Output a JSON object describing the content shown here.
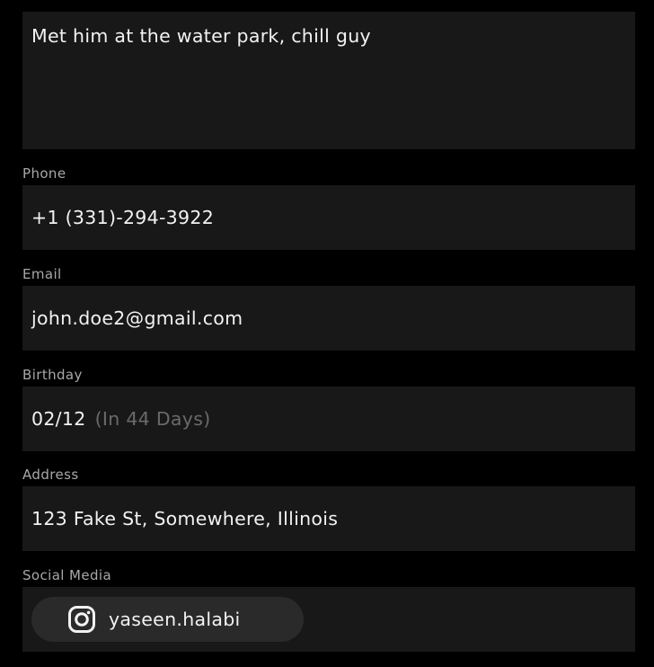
{
  "notes": {
    "text": "Met him at the water park, chill guy"
  },
  "phone": {
    "label": "Phone",
    "value": "+1 (331)-294-3922"
  },
  "email": {
    "label": "Email",
    "value": "john.doe2@gmail.com"
  },
  "birthday": {
    "label": "Birthday",
    "value": "02/12",
    "countdown": "(In 44 Days)"
  },
  "address": {
    "label": "Address",
    "value": "123 Fake St, Somewhere, Illinois"
  },
  "social": {
    "label": "Social Media",
    "items": [
      {
        "icon": "instagram-icon",
        "handle": "yaseen.halabi"
      }
    ]
  },
  "colors": {
    "background": "#000000",
    "field": "#181818",
    "chip": "#2a2a2a",
    "label": "#a8a8a8",
    "muted": "#6a6a6a",
    "text": "#f2f2f2"
  }
}
